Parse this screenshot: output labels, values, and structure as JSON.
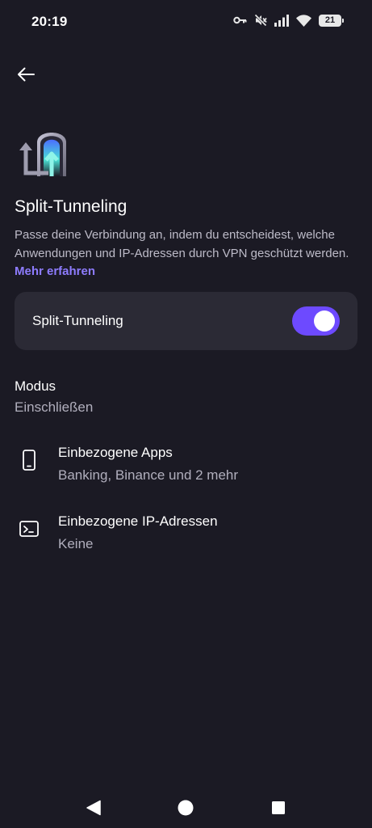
{
  "status_bar": {
    "time": "20:19",
    "battery": "21",
    "icons": [
      "vpn-key-icon",
      "mute-icon",
      "signal-icon",
      "wifi-icon",
      "battery-icon"
    ]
  },
  "header": {
    "back_icon": "arrow-left-icon"
  },
  "page": {
    "title": "Split-Tunneling",
    "description": "Passe deine Verbindung an, indem du entscheidest, welche Anwendungen und IP-Adressen durch VPN geschützt werden.",
    "learn_more": "Mehr erfahren"
  },
  "toggle": {
    "label": "Split-Tunneling",
    "enabled": true
  },
  "mode": {
    "label": "Modus",
    "value": "Einschließen"
  },
  "items": [
    {
      "icon": "smartphone-icon",
      "title": "Einbezogene Apps",
      "subtitle": "Banking, Binance und 2 mehr"
    },
    {
      "icon": "terminal-icon",
      "title": "Einbezogene IP-Adressen",
      "subtitle": "Keine"
    }
  ],
  "colors": {
    "background": "#1b1a24",
    "card": "#2b2a35",
    "accent": "#6d4aff",
    "link": "#8e7cff",
    "secondary_text": "#b1afbd"
  },
  "nav_bar": {
    "buttons": [
      "back-triangle-icon",
      "home-circle-icon",
      "recents-square-icon"
    ]
  }
}
